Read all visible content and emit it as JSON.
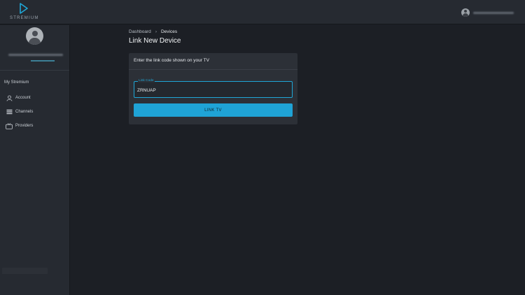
{
  "app": {
    "logo_text": "STREMIUM"
  },
  "sidebar": {
    "section_title": "My Stremium",
    "items": [
      {
        "label": "Account",
        "icon": "user-icon"
      },
      {
        "label": "Channels",
        "icon": "channels-icon"
      },
      {
        "label": "Providers",
        "icon": "tv-icon"
      }
    ]
  },
  "breadcrumb": {
    "parent": "Dashboard",
    "separator": "›",
    "current": "Devices"
  },
  "page": {
    "title": "Link New Device"
  },
  "card": {
    "header": "Enter the link code shown on your TV",
    "field_label": "Link Code",
    "field_value": "ZRNUAP",
    "button_label": "LINK TV"
  },
  "colors": {
    "accent": "#1fa3d6",
    "background": "#1c1f25",
    "panel": "#262a31"
  }
}
